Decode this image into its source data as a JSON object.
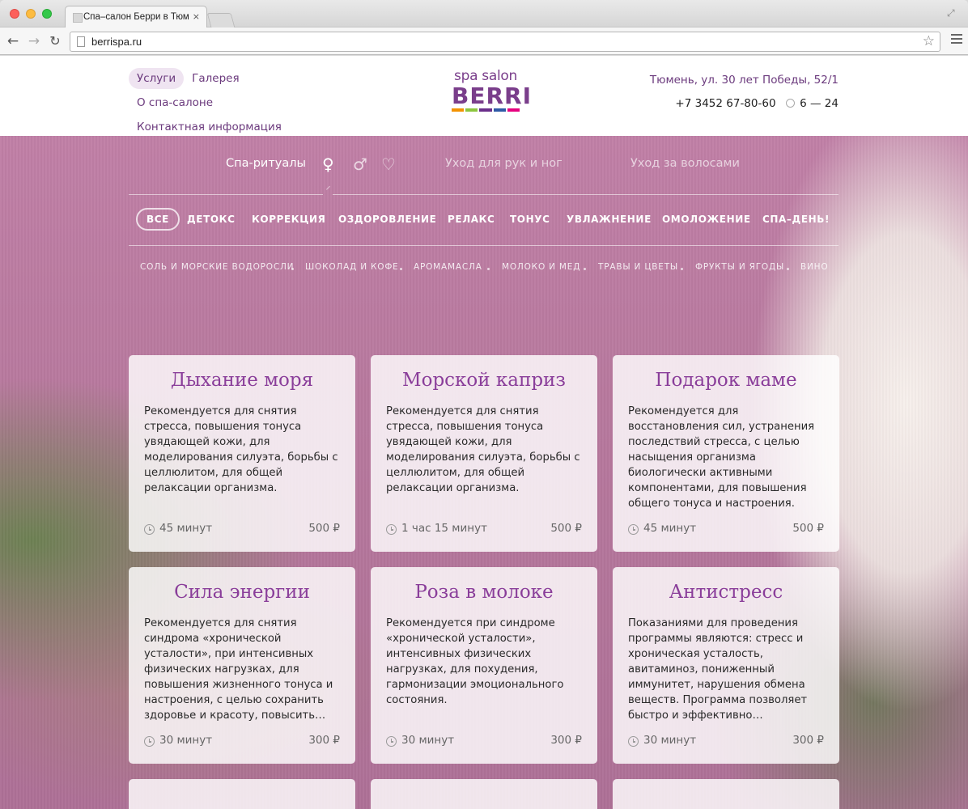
{
  "browser": {
    "tab_title": "Спа–салон Берри в Тюмени",
    "tab_close": "×",
    "url": "berrispa.ru",
    "back_glyph": "←",
    "forward_glyph": "→",
    "reload_glyph": "↻",
    "star_glyph": "☆",
    "fullscreen_glyph": "⤢"
  },
  "header": {
    "nav": [
      "Услуги",
      "Галерея",
      "О спа-салоне",
      "Контактная информация"
    ],
    "active_nav": "Услуги",
    "logo_top": "spa salon",
    "logo_main": "BERRI",
    "logo_colors": [
      "#f39200",
      "#8cc63f",
      "#6a2e8a",
      "#2f5aa6",
      "#e6007e"
    ],
    "address": "Тюмень, ул. 30 лет Победы, 52/1",
    "phone": "+7 3452 67-80-60",
    "hours": "6 — 24"
  },
  "categories": {
    "items": [
      "Спа-ритуалы",
      "Уход для рук и ног",
      "Уход за волосами"
    ],
    "gender_icons": {
      "female": "♀",
      "male": "♂",
      "couple": "♡"
    }
  },
  "filters": {
    "items": [
      "ВСЕ",
      "ДЕТОКС",
      "КОРРЕКЦИЯ",
      "ОЗДОРОВЛЕНИЕ",
      "РЕЛАКС",
      "ТОНУС",
      "УВЛАЖНЕНИЕ",
      "ОМОЛОЖЕНИЕ",
      "СПА–ДЕНЬ!"
    ],
    "active": "ВСЕ"
  },
  "subfilters": {
    "items": [
      "СОЛЬ И МОРСКИЕ ВОДОРОСЛИ",
      "ШОКОЛАД И КОФЕ",
      "АРОМАМАСЛА",
      "МОЛОКО И МЕД",
      "ТРАВЫ И ЦВЕТЫ",
      "ФРУКТЫ И ЯГОДЫ",
      "ВИНО"
    ]
  },
  "cards": [
    {
      "title": "Дыхание моря",
      "description": "Рекомендуется для снятия стресса, повышения тонуса увядающей кожи, для моделирования силуэта, борьбы с целлюлитом, для общей релаксации организма.",
      "duration": "45 минут",
      "price": "500 ₽"
    },
    {
      "title": "Морской каприз",
      "description": "Рекомендуется для снятия стресса, повышения тонуса увядающей кожи, для моделирования силуэта, борьбы с целлюлитом, для общей релаксации организма.",
      "duration": "1 час 15 минут",
      "price": "500 ₽"
    },
    {
      "title": "Подарок маме",
      "description": "Рекомендуется для восстановления сил, устранения последствий стресса, с целью насыщения организма биологически активными компонентами, для повышения общего тонуса и настроения.",
      "duration": "45 минут",
      "price": "500 ₽"
    },
    {
      "title": "Сила энергии",
      "description": "Рекомендуется для снятия синдрома «хронической усталости», при интенсивных физических нагрузках, для повышения жизненного тонуса и настроения, с целью сохранить здоровье и красоту, повысить…",
      "duration": "30 минут",
      "price": "300 ₽"
    },
    {
      "title": "Роза в молоке",
      "description": "Рекомендуется при синдроме «хронической усталости», интенсивных физических нагрузках, для похудения, гармонизации эмоционального состояния.",
      "duration": "30 минут",
      "price": "300 ₽"
    },
    {
      "title": "Антистресс",
      "description": "Показаниями для проведения программы являются: стресс и хроническая усталость, авитаминоз, пониженный иммунитет, нарушения обмена веществ. Программа позволяет быстро и эффективно…",
      "duration": "30 минут",
      "price": "300 ₽"
    }
  ]
}
